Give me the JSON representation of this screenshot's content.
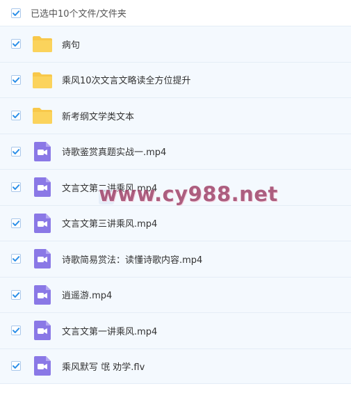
{
  "header": {
    "selection_text": "已选中10个文件/文件夹"
  },
  "items": [
    {
      "name": "病句",
      "type": "folder",
      "icon": "folder-icon"
    },
    {
      "name": "乘风10次文言文略读全方位提升",
      "type": "folder",
      "icon": "folder-icon"
    },
    {
      "name": "新考纲文学类文本",
      "type": "folder",
      "icon": "folder-icon"
    },
    {
      "name": "诗歌鉴赏真题实战一.mp4",
      "type": "video",
      "icon": "video-file-icon"
    },
    {
      "name": "文言文第二讲乘风.mp4",
      "type": "video",
      "icon": "video-file-icon"
    },
    {
      "name": "文言文第三讲乘风.mp4",
      "type": "video",
      "icon": "video-file-icon"
    },
    {
      "name": "诗歌简易赏法：读懂诗歌内容.mp4",
      "type": "video",
      "icon": "video-file-icon"
    },
    {
      "name": "逍遥游.mp4",
      "type": "video",
      "icon": "video-file-icon"
    },
    {
      "name": "文言文第一讲乘风.mp4",
      "type": "video",
      "icon": "video-file-icon"
    },
    {
      "name": "乘风默写 氓 劝学.flv",
      "type": "video",
      "icon": "video-file-icon"
    }
  ],
  "watermark": {
    "text": "www.cy988.net"
  },
  "colors": {
    "check": "#2b8fe8",
    "folder": "#f8c84a",
    "video": "#8a78e6",
    "row_bg": "#f4f9fe"
  }
}
